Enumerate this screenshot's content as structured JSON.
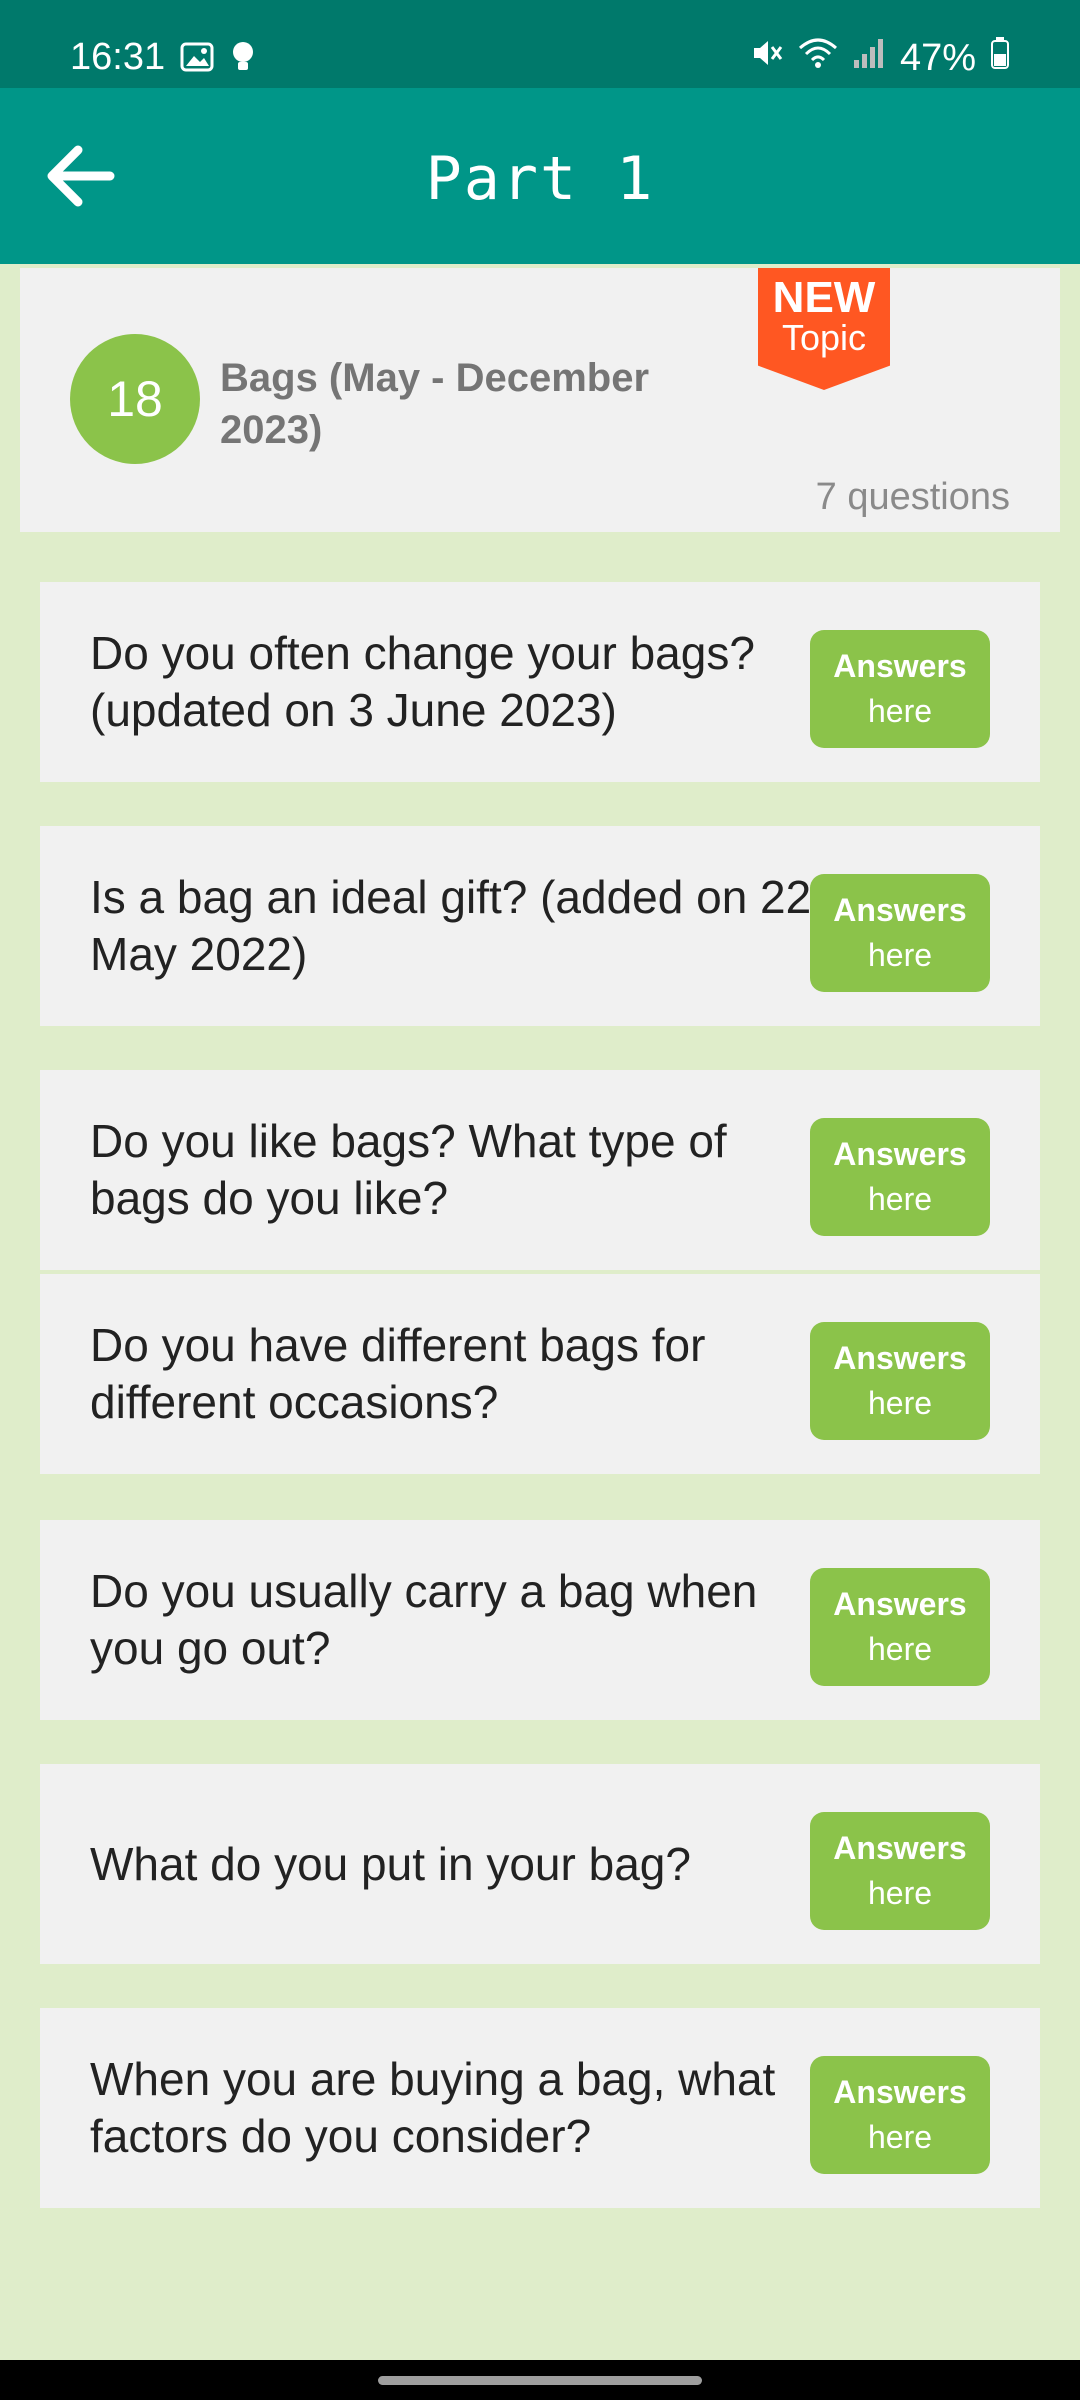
{
  "status": {
    "time": "16:31",
    "battery": "47%",
    "icons": [
      "image-icon",
      "bulb-icon",
      "mute-icon",
      "wifi-icon",
      "signal-icon",
      "battery-icon"
    ]
  },
  "appbar": {
    "title": "Part 1",
    "back_icon": "arrow-left-icon"
  },
  "topic": {
    "number": "18",
    "title": "Bags (May - December 2023)",
    "badge_main": "NEW",
    "badge_sub": "Topic",
    "count": "7 questions"
  },
  "answer_button": {
    "main": "Answers",
    "sub": "here"
  },
  "questions": [
    {
      "text": "Do you often change your bags? (updated on 3 June 2023)"
    },
    {
      "text": "Is a bag an ideal gift? (added on 22 May 2022)"
    },
    {
      "text": "Do you like bags? What type of bags do you like?"
    },
    {
      "text": "Do you have different bags for different occasions?"
    },
    {
      "text": "Do you usually carry a bag when you go out?"
    },
    {
      "text": "What do you put in your bag?"
    },
    {
      "text": "When you are buying a bag, what factors do you consider?"
    }
  ],
  "colors": {
    "status_bar": "#00796b",
    "app_bar": "#009688",
    "background": "#dfedca",
    "accent_green": "#8bc34a",
    "badge_orange": "#ff5722"
  }
}
